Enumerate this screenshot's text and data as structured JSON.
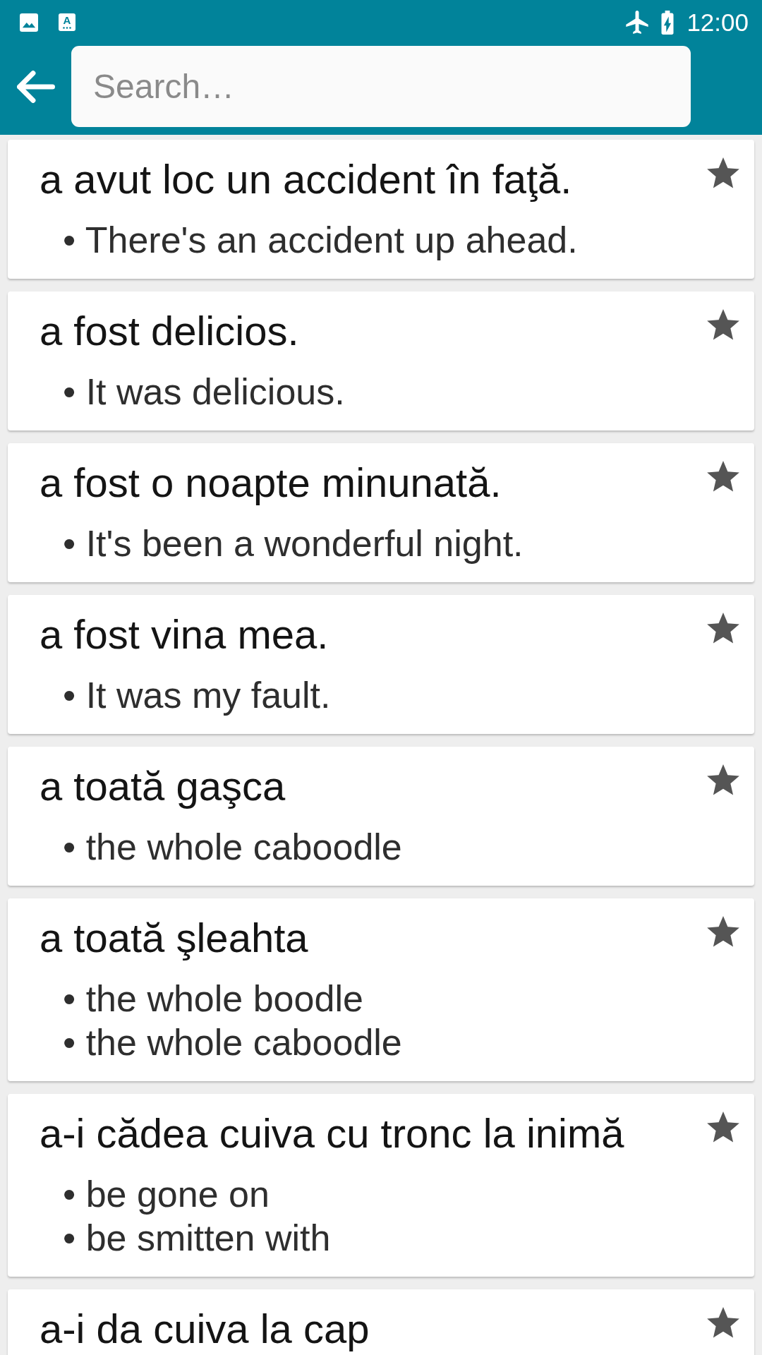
{
  "status_bar": {
    "notifications": [
      {
        "kind": "image"
      },
      {
        "kind": "app",
        "letter": "A"
      }
    ],
    "time": "12:00"
  },
  "search": {
    "placeholder": "Search…"
  },
  "entries": [
    {
      "phrase": "a avut loc un accident în faţă.",
      "meanings": [
        "• There's an accident up ahead."
      ]
    },
    {
      "phrase": "a fost delicios.",
      "meanings": [
        "• It was delicious."
      ]
    },
    {
      "phrase": "a fost o noapte minunată.",
      "meanings": [
        "• It's been a wonderful night."
      ]
    },
    {
      "phrase": "a fost vina mea.",
      "meanings": [
        "• It was my fault."
      ]
    },
    {
      "phrase": "a toată gaşca",
      "meanings": [
        "• the whole caboodle"
      ]
    },
    {
      "phrase": "a toată şleahta",
      "meanings": [
        "• the whole boodle",
        "• the whole caboodle"
      ]
    },
    {
      "phrase": "a-i cădea cuiva cu tronc la inimă",
      "meanings": [
        "• be gone on",
        "• be smitten with"
      ]
    },
    {
      "phrase": "a-i da cuiva la cap"
    }
  ]
}
